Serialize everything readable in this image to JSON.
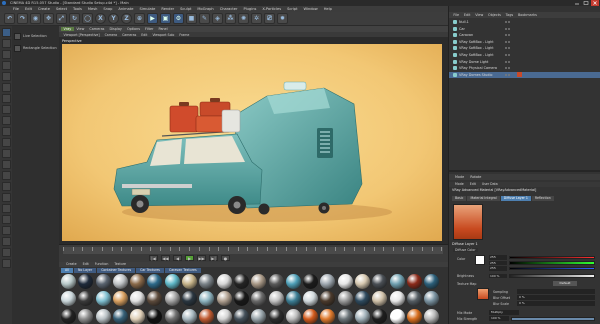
{
  "window": {
    "title": "CINEMA 4D R15.057 Studio - [Standard Studio Setup.c4d *] - Main"
  },
  "menubar": {
    "items": [
      "File",
      "Edit",
      "Create",
      "Select",
      "Tools",
      "Mesh",
      "Snap",
      "Animate",
      "Simulate",
      "Render",
      "Sculpt",
      "MoGraph",
      "Character",
      "Plugins",
      "X-Particles",
      "Script",
      "Window",
      "Help"
    ],
    "layout_label": "Layout: RTE_2016 (User)"
  },
  "toolbar": {
    "icons": [
      "undo-icon",
      "redo-icon",
      "live-select-icon",
      "move-icon",
      "scale-icon",
      "rotate-icon",
      "recent-tool-icon",
      "x-axis-icon",
      "y-axis-icon",
      "z-axis-icon",
      "coord-system-icon",
      "render-view-icon",
      "render-picture-viewer-icon",
      "render-settings-icon",
      "cube-icon",
      "pen-icon",
      "subdivision-icon",
      "array-icon",
      "environment-icon",
      "deformer-icon",
      "camera-icon",
      "light-icon"
    ],
    "glyphs": [
      "↶",
      "↷",
      "◉",
      "✥",
      "⤢",
      "↻",
      "◯",
      "X",
      "Y",
      "Z",
      "⊕",
      "▶",
      "▣",
      "⚙",
      "■",
      "✎",
      "◈",
      "⁂",
      "✺",
      "✲",
      "⎚",
      "✹"
    ]
  },
  "left_panel": {
    "items": [
      "Live Selection",
      "Rectangle Selection"
    ]
  },
  "viewport": {
    "menu": [
      "Vray",
      "View",
      "Cameras",
      "Display",
      "Options",
      "Filter",
      "Panel"
    ],
    "menu_active": "Vray",
    "sub_menu": [
      "Viewport [Perspective]",
      "Camera",
      "Cameras",
      "Edit",
      "Viewport Solo",
      "Frame"
    ],
    "view_label": "Perspective"
  },
  "timeline": {
    "controls": [
      "|◀",
      "◀◀",
      "◀",
      "▶",
      "▶▶",
      "▶|",
      "●"
    ]
  },
  "material_manager": {
    "menu": [
      "Create",
      "Edit",
      "Function",
      "Texture"
    ],
    "tabs": [
      "All",
      "No Layer",
      "Container Textures",
      "Car Textures",
      "Caravan Textures"
    ],
    "selected_tab": "All",
    "swatches": [
      "#b7c8c8",
      "#1e2a3a",
      "#5a6470",
      "#bfc3c6",
      "#8a6a4a",
      "#2d6a8a",
      "#5fb8c8",
      "#c7b48a",
      "#7a8288",
      "#d7d7d7",
      "#242424",
      "#a89886",
      "#595959",
      "#4ea0b8",
      "#1b1b1b",
      "#9fa8b0",
      "#e6e6e6",
      "#d6c8b0",
      "#4a4f55",
      "#6fa0b0",
      "#8b2a1a",
      "#2b5f7a",
      "#c9d6da",
      "#3b3b3b",
      "#7fbfd0",
      "#d9a060",
      "#e2e2e2",
      "#5d4b3c",
      "#a3a3a3",
      "#2a3640",
      "#8eb4c0",
      "#b0a090",
      "#181818",
      "#6a6a6a",
      "#c2c2c2",
      "#3c7e94",
      "#d0d8dc",
      "#4b3a2c",
      "#9a9a9a",
      "#2e4a5e",
      "#cfc0a8",
      "#e8e8e8",
      "#555d63",
      "#7a92a0",
      "#222222",
      "#8c8c8c",
      "#b8c0c4",
      "#366078",
      "#e0d0b8",
      "#101010",
      "#707070",
      "#a8b8c0",
      "#c05a30",
      "#d4d4d4",
      "#44505a",
      "#98a4aa",
      "#2c2c2c",
      "#bcbcbc",
      "#d25a1c",
      "#e07a2c",
      "#6b7479",
      "#a0b0b8",
      "#1e1e1e",
      "#ffffff",
      "#d86e1e",
      "#b8b8b8"
    ]
  },
  "object_manager": {
    "header": [
      "File",
      "Edit",
      "View",
      "Objects",
      "Tags",
      "Bookmarks"
    ],
    "objects": [
      {
        "name": "Null.1",
        "icon": "null-icon",
        "selected": false
      },
      {
        "name": "Car",
        "icon": "null-icon",
        "selected": false
      },
      {
        "name": "Caravan",
        "icon": "null-icon",
        "selected": false
      },
      {
        "name": "VRay SoftBox - Light",
        "icon": "light-icon",
        "selected": false
      },
      {
        "name": "VRay SoftBox - Light",
        "icon": "light-icon",
        "selected": false
      },
      {
        "name": "VRay SoftBox - Light",
        "icon": "light-icon",
        "selected": false
      },
      {
        "name": "VRay Dome Light",
        "icon": "light-icon",
        "selected": false
      },
      {
        "name": "VRay Physical Camera",
        "icon": "camera-icon",
        "selected": false
      },
      {
        "name": "VRay Domes Studio",
        "icon": "environment-icon",
        "selected": true
      }
    ]
  },
  "attributes": {
    "tabs": [
      "Mode",
      "Rotate"
    ],
    "menu": [
      "Mode",
      "Edit",
      "User Data"
    ],
    "material_name": "VRay Advanced Material [VRayAdvancedMaterial]",
    "subtabs": [
      "Basic",
      "Material Integral",
      "Diffuse Layer 1",
      "Reflection"
    ],
    "selected_subtab": "Diffuse Layer 1",
    "section": "Diffuse Layer 1",
    "subsection": "Diffuse Color",
    "color_label": "Color",
    "color_values": [
      "255",
      "255",
      "255"
    ],
    "brightness_label": "Brightness",
    "brightness_value": "100 %",
    "texture_label": "Texture Map",
    "texture_mode": "Default",
    "sampling_label": "Sampling",
    "blur_offset_label": "Blur Offset",
    "blur_offset_value": "0 %",
    "blur_scale_label": "Blur Scale",
    "blur_scale_value": "0 %",
    "mix_mode_label": "Mix Mode",
    "mix_mode_value": "Multiply",
    "mix_strength_label": "Mix Strength",
    "mix_strength_value": "100 %"
  },
  "colors": {
    "accent_blue": "#4d7fb0",
    "active_green": "#5a7a42",
    "backdrop": "#f2c774",
    "car_teal": "#5aa0a0",
    "caravan_teal": "#4f9a98",
    "luggage_red": "#c84a2a"
  }
}
